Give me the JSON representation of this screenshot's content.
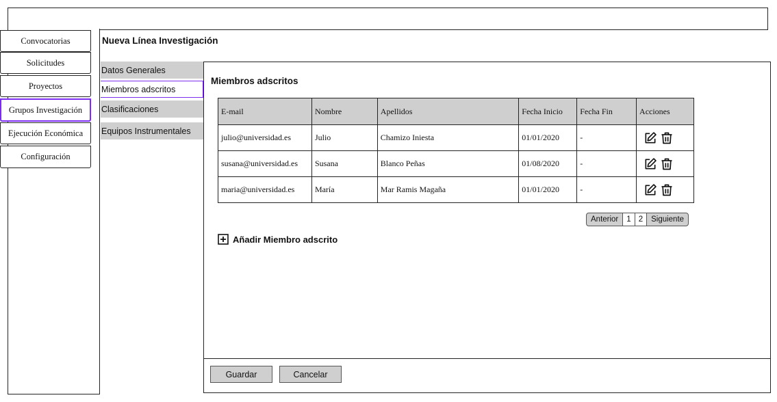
{
  "sidebar": {
    "items": [
      {
        "label": "Convocatorias"
      },
      {
        "label": "Solicitudes"
      },
      {
        "label": "Proyectos"
      },
      {
        "label": "Grupos Investigación"
      },
      {
        "label": "Ejecución Económica"
      },
      {
        "label": "Configuración"
      }
    ],
    "active": "Grupos Investigación"
  },
  "page": {
    "title": "Nueva Línea Investigación"
  },
  "subnav": {
    "items": [
      {
        "label": "Datos Generales"
      },
      {
        "label": "Miembros adscritos"
      },
      {
        "label": "Clasificaciones"
      },
      {
        "label": "Equipos Instrumentales"
      }
    ],
    "active": "Miembros adscritos"
  },
  "section": {
    "title": "Miembros adscritos"
  },
  "table": {
    "headers": [
      "E-mail",
      "Nombre",
      "Apellidos",
      "Fecha Inicio",
      "Fecha Fin",
      "Acciones"
    ],
    "rows": [
      [
        "julio@universidad.es",
        "Julio",
        "Chamizo Iniesta",
        "01/01/2020",
        "-"
      ],
      [
        "susana@universidad.es",
        "Susana",
        "Blanco Peñas",
        "01/08/2020",
        "-"
      ],
      [
        "maria@universidad.es",
        "María",
        "Mar Ramis Magaña",
        "01/01/2020",
        "-"
      ]
    ],
    "row_icons": [
      "edit-icon",
      "trash-icon"
    ]
  },
  "pagination": {
    "prev": "Anterior",
    "pages": [
      "1",
      "2"
    ],
    "next": "Siguiente"
  },
  "add_member": {
    "label": "Añadir Miembro adscrito",
    "icon": "plus-square-icon"
  },
  "footer": {
    "save": "Guardar",
    "cancel": "Cancelar"
  },
  "colors": {
    "accent": "#7b2cf0",
    "header_bg": "#cfcfcf"
  }
}
